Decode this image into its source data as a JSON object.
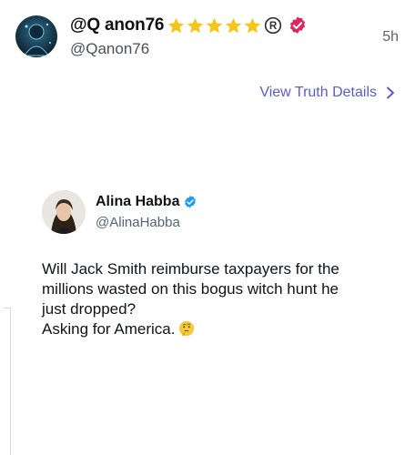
{
  "post": {
    "display_name": "@Q anon76",
    "handle": "@Qanon76",
    "timestamp": "5h",
    "star_count": 5,
    "view_details_label": "View Truth Details"
  },
  "quoted": {
    "name": "Alina Habba",
    "handle": "@AlinaHabba",
    "body_lines": [
      "Will Jack Smith reimburse taxpayers for the",
      "millions wasted on this bogus witch hunt he",
      "just dropped?",
      "Asking for America."
    ]
  },
  "icons": {
    "star": "star-icon",
    "registered": "registered-icon",
    "verified": "verified-badge-icon",
    "chevron": "chevron-right-icon",
    "emoji": "thinking-face-emoji"
  },
  "colors": {
    "link": "#5b5ccf",
    "star": "#f5c518",
    "verified_pink": "#e0245e",
    "quoted_verified": "#1d9bf0"
  }
}
